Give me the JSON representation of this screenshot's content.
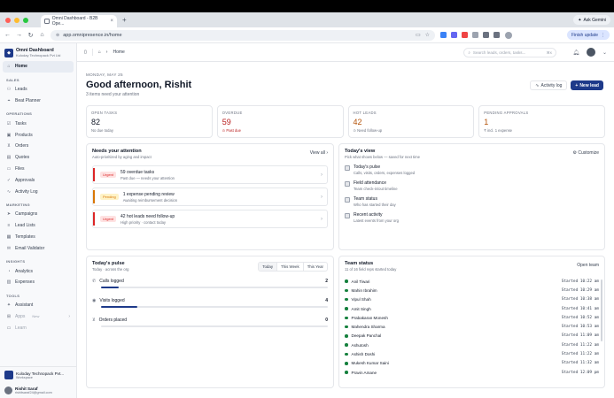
{
  "browser": {
    "tab_title": "Omni Dashboard - B2B Ope...",
    "url": "app.omnipresence.in/home",
    "ask_gemini": "Ask Gemini",
    "finish_update": "Finish update",
    "colors": {
      "close": "#ff5f57",
      "min": "#febc2e",
      "max": "#28c840"
    }
  },
  "sidebar": {
    "org_name": "Omni Dashboard",
    "org_sub": "Kuloday Technopack Pvt Ltd",
    "home": "Home",
    "sections": [
      {
        "title": "SALES",
        "items": [
          {
            "label": "Leads",
            "icon": "users-icon"
          },
          {
            "label": "Beat Planner",
            "icon": "map-pin-icon"
          }
        ]
      },
      {
        "title": "OPERATIONS",
        "items": [
          {
            "label": "Tasks",
            "icon": "check-square-icon"
          },
          {
            "label": "Products",
            "icon": "box-icon"
          },
          {
            "label": "Orders",
            "icon": "cart-icon"
          },
          {
            "label": "Quotes",
            "icon": "file-text-icon"
          },
          {
            "label": "Files",
            "icon": "folder-icon"
          },
          {
            "label": "Approvals",
            "icon": "check-circle-icon"
          },
          {
            "label": "Activity Log",
            "icon": "activity-icon"
          }
        ]
      },
      {
        "title": "MARKETING",
        "items": [
          {
            "label": "Campaigns",
            "icon": "send-icon"
          },
          {
            "label": "Lead Lists",
            "icon": "list-icon"
          },
          {
            "label": "Templates",
            "icon": "template-icon"
          },
          {
            "label": "Email Validator",
            "icon": "mail-icon"
          }
        ]
      },
      {
        "title": "INSIGHTS",
        "items": [
          {
            "label": "Analytics",
            "icon": "chart-icon"
          },
          {
            "label": "Expenses",
            "icon": "wallet-icon"
          }
        ]
      },
      {
        "title": "TOOLS",
        "items": [
          {
            "label": "Assistant",
            "icon": "sparkle-icon"
          }
        ]
      }
    ],
    "apps": "Apps",
    "apps_badge": "New",
    "learn": "Learn",
    "workspace_name": "Kuloday Technopack Pvt...",
    "workspace_sub": "Workspace",
    "user_name": "Rishit Saraf",
    "user_email": "rishitsaraf24@gmail.com"
  },
  "topbar": {
    "breadcrumb": "Home",
    "search_placeholder": "Search leads, orders, tasks...",
    "search_kbd": "⌘K"
  },
  "header": {
    "date": "MONDAY, MAY 25",
    "greeting": "Good afternoon, Rishit",
    "subtitle": "3 items need your attention",
    "activity_log": "Activity log",
    "new_lead": "New lead"
  },
  "stats": [
    {
      "label": "OPEN TASKS",
      "value": "82",
      "sub": "No due today",
      "tone": ""
    },
    {
      "label": "OVERDUE",
      "value": "59",
      "sub": "⊙ Past due",
      "tone": "red"
    },
    {
      "label": "HOT LEADS",
      "value": "42",
      "sub": "⊙ Need follow-up",
      "tone": "orange"
    },
    {
      "label": "PENDING APPROVALS",
      "value": "1",
      "sub": "₹ incl. 1 expense",
      "tone": "orange"
    }
  ],
  "attention": {
    "title": "Needs your attention",
    "subtitle": "Auto-prioritized by aging and impact",
    "view_all": "View all ›",
    "items": [
      {
        "badge": "Urgent",
        "title": "59 overdue tasks",
        "sub": "Past due — needs your attention",
        "color": "#dc2626",
        "badge_bg": "#fee2e2"
      },
      {
        "badge": "Pending",
        "title": "1 expense pending review",
        "sub": "Awaiting reimbursement decision",
        "color": "#d97706",
        "badge_bg": "#fef3c7"
      },
      {
        "badge": "Urgent",
        "title": "42 hot leads need follow-up",
        "sub": "High priority · contact today",
        "color": "#dc2626",
        "badge_bg": "#fee2e2"
      }
    ]
  },
  "todays_view": {
    "title": "Today's view",
    "subtitle": "Pick what shows below — saved for next time",
    "customize": "Customize",
    "items": [
      {
        "title": "Today's pulse",
        "sub": "Calls, visits, orders, expenses logged"
      },
      {
        "title": "Field attendance",
        "sub": "Team check-in/out timeline"
      },
      {
        "title": "Team status",
        "sub": "Who has started their day"
      },
      {
        "title": "Recent activity",
        "sub": "Latest events from your org"
      }
    ]
  },
  "pulse": {
    "title": "Today's pulse",
    "subtitle": "Today · across the org",
    "ranges": [
      "Today",
      "This Week",
      "This Year"
    ],
    "rows": [
      {
        "label": "Calls logged",
        "value": "2",
        "icon": "phone-icon",
        "fill": 0.08
      },
      {
        "label": "Visits logged",
        "value": "4",
        "icon": "location-icon",
        "fill": 0.16
      },
      {
        "label": "Orders placed",
        "value": "0",
        "icon": "cart-icon",
        "fill": 0
      }
    ]
  },
  "team": {
    "title": "Team status",
    "subtitle": "11 of 16 field reps started today",
    "open_team": "Open team",
    "rows": [
      {
        "name": "Anil Tiwari",
        "when": "Started 10:22 am"
      },
      {
        "name": "Mahin Ibrahim",
        "when": "Started 10:29 am"
      },
      {
        "name": "Vipul Shah",
        "when": "Started 10:38 am"
      },
      {
        "name": "Amit Singh",
        "when": "Started 10:41 am"
      },
      {
        "name": "Prabakaran Monesh",
        "when": "Started 10:52 am"
      },
      {
        "name": "Mahendra Sharma",
        "when": "Started 10:53 am"
      },
      {
        "name": "Deepak Panchal",
        "when": "Started 11:09 am"
      },
      {
        "name": "Ashutosh",
        "when": "Started 11:22 am"
      },
      {
        "name": "Ashish Doshi",
        "when": "Started 11:22 am"
      },
      {
        "name": "Mukesh Kumar Saini",
        "when": "Started 11:32 am"
      },
      {
        "name": "Pravin Amane",
        "when": "Started 12:09 pm"
      }
    ]
  }
}
